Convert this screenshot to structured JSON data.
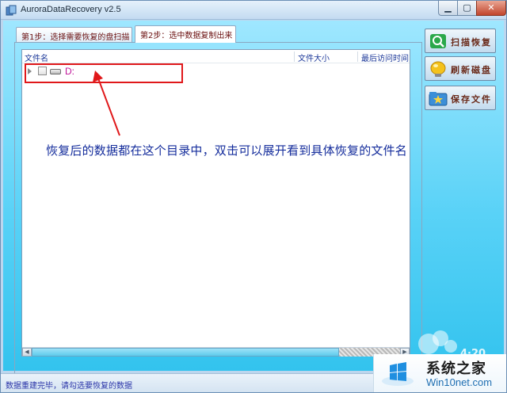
{
  "window": {
    "title": "AuroraDataRecovery v2.5",
    "minimize_glyph": "▁",
    "maximize_glyph": "▢",
    "close_glyph": "✕"
  },
  "tabs": [
    {
      "label": "第1步：选择需要恢复的盘扫描"
    },
    {
      "label": "第2步：选中数据复制出来"
    }
  ],
  "list": {
    "columns": [
      "文件名",
      "文件大小",
      "最后访问时间"
    ],
    "rows": [
      {
        "label": "D:",
        "checked": false,
        "icon": "drive-icon"
      }
    ]
  },
  "annotation": "恢复后的数据都在这个目录中，双击可以展开看到具体恢复的文件名",
  "scrollbar": {
    "left_glyph": "◀",
    "right_glyph": "▶"
  },
  "buttons": {
    "scan": "扫描恢复",
    "refresh": "刷新磁盘",
    "save": "保存文件"
  },
  "status": "数据重建完毕，请勾选要恢复的数据",
  "watermark": {
    "faint": "4·20",
    "title": "系统之家",
    "url": "Win10net.com"
  },
  "colors": {
    "client_gradient_top": "#9fe7ff",
    "client_gradient_bottom": "#33c3ee",
    "highlight_box": "#e0181a",
    "annotation_text": "#152d9c",
    "drive_label": "#c0179a"
  }
}
